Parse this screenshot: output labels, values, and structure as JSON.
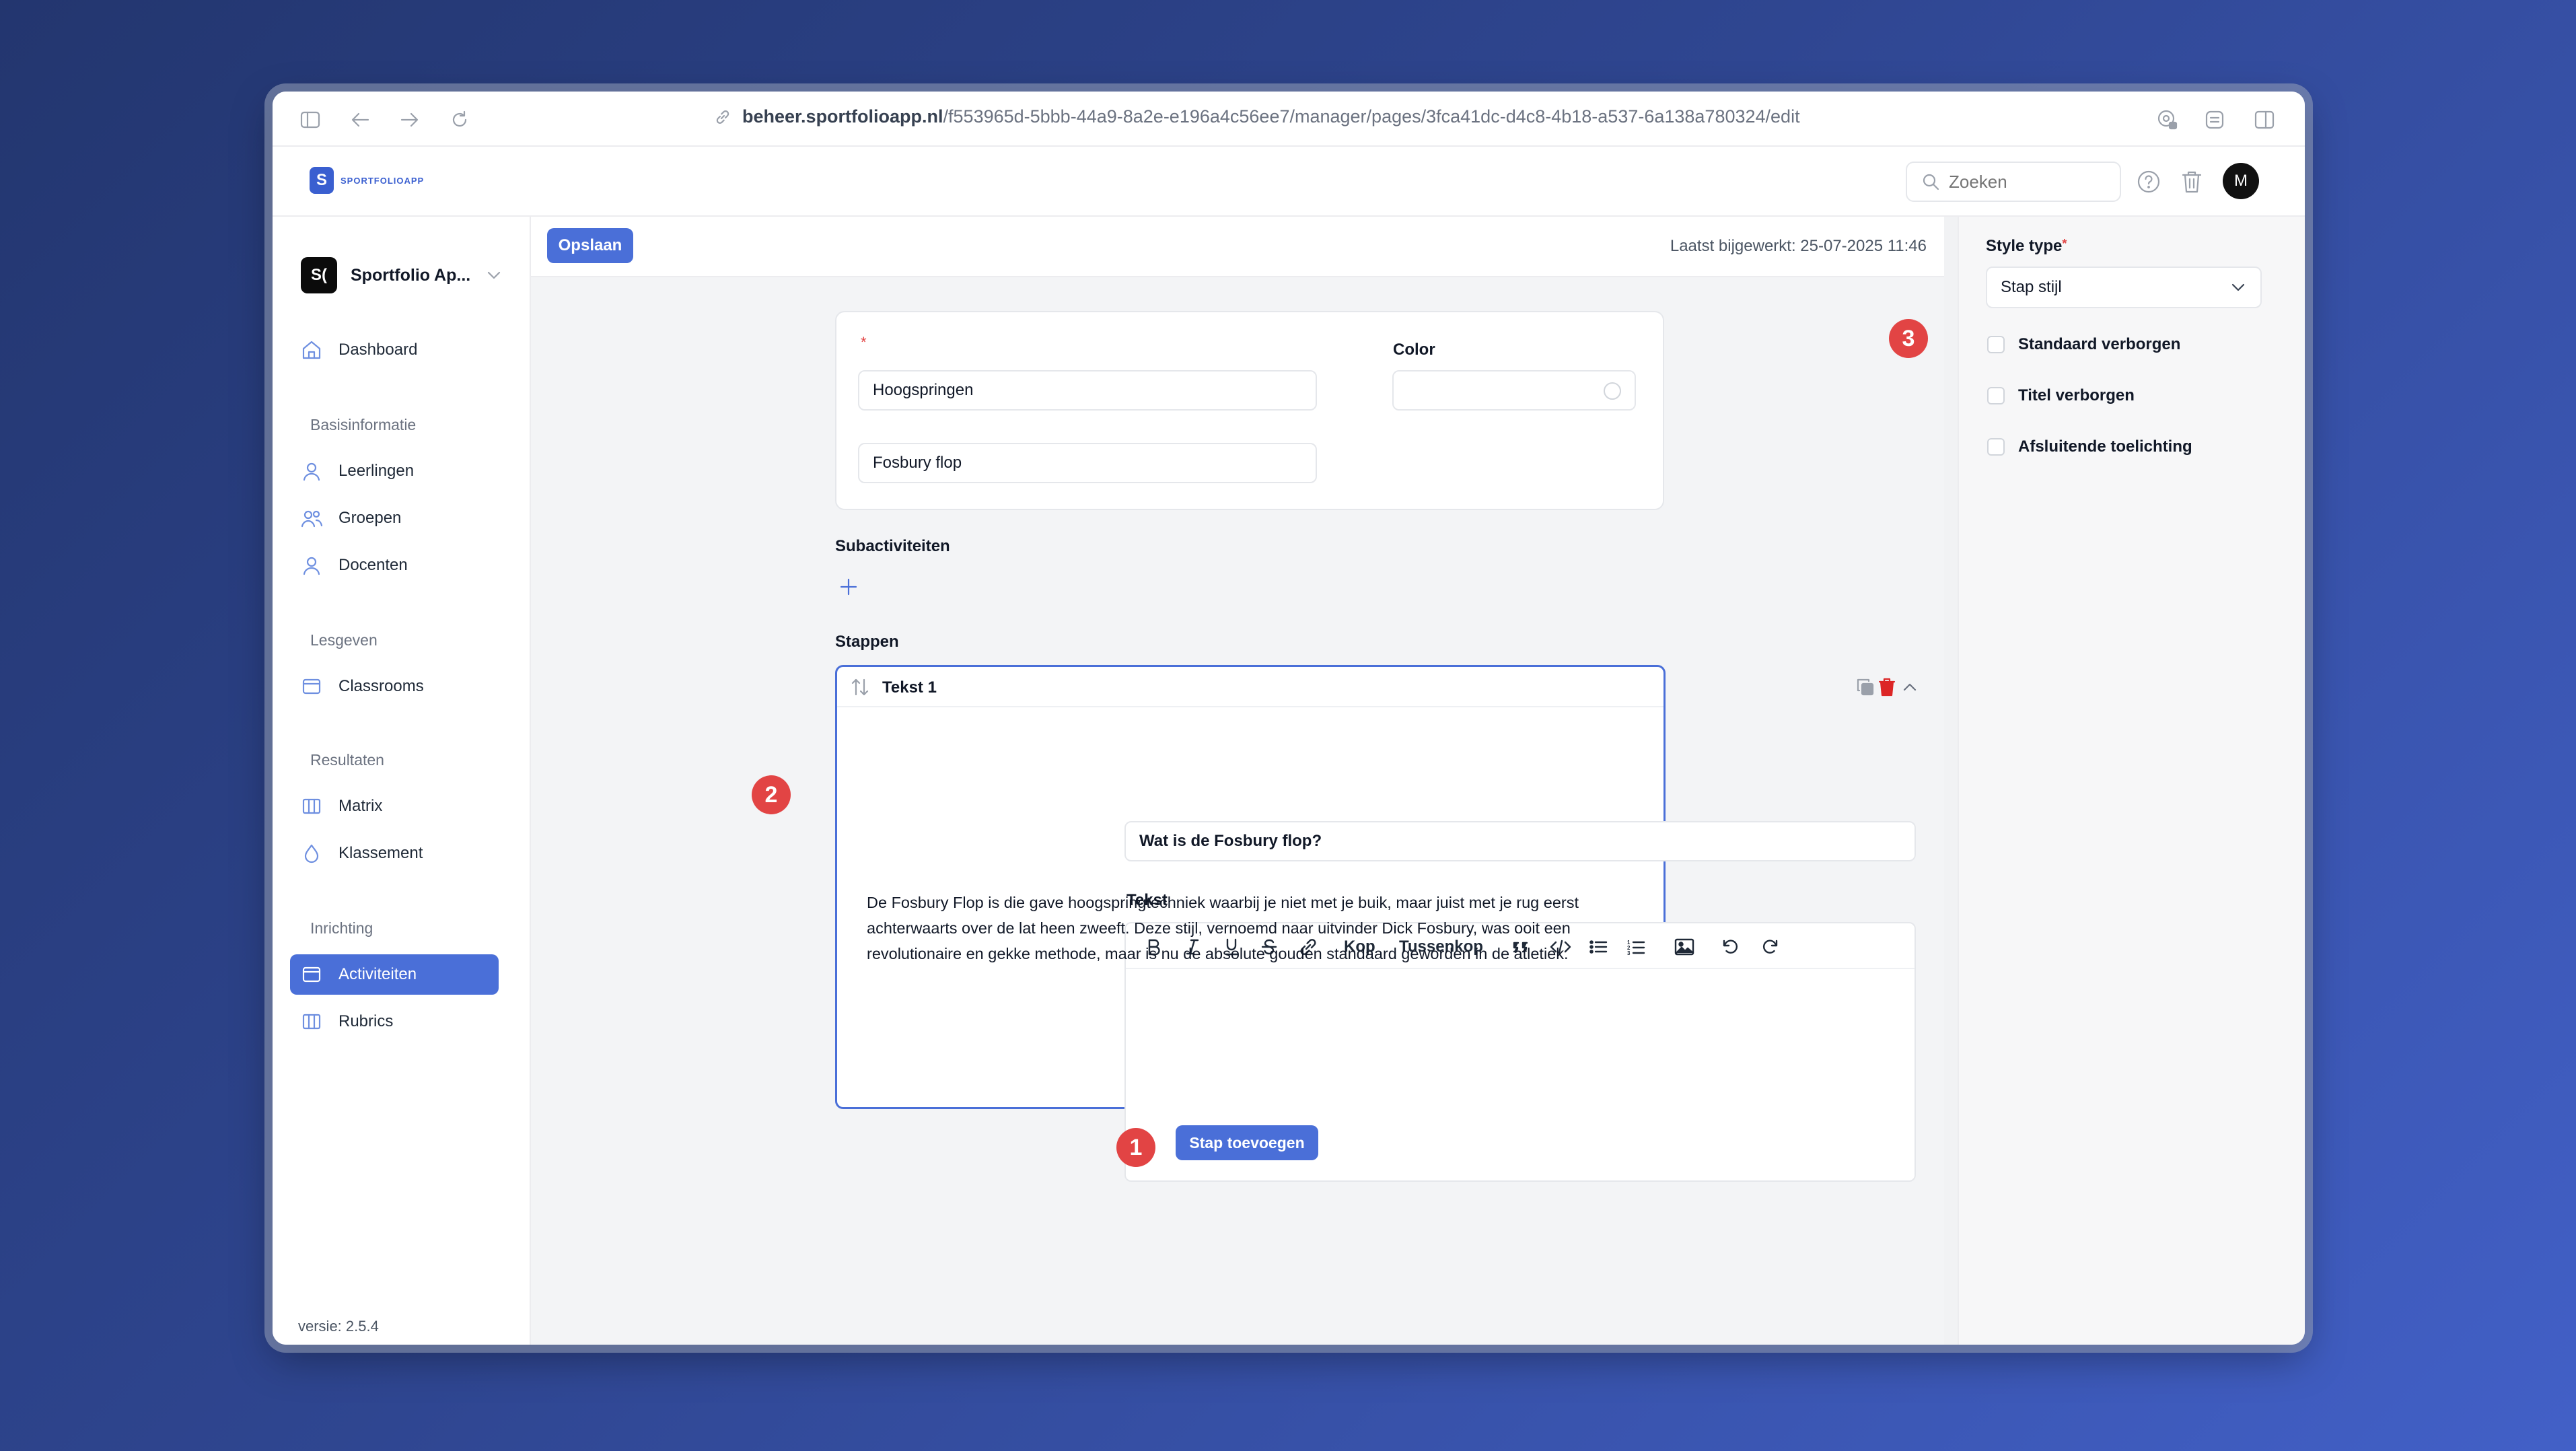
{
  "browser": {
    "url_host": "beheer.sportfolioapp.nl",
    "url_path": "/f553965d-5bbb-44a9-8a2e-e196a4c56ee7/manager/pages/3fca41dc-d4c8-4b18-a537-6a138a780324/edit"
  },
  "app": {
    "logo_text": "SPORTFOLIOAPP",
    "search_placeholder": "Zoeken",
    "avatar_initial": "M"
  },
  "sidebar": {
    "workspace": {
      "initials": "S(",
      "name": "Sportfolio Ap..."
    },
    "dashboard": "Dashboard",
    "sections": [
      {
        "title": "Basisinformatie",
        "items": [
          "Leerlingen",
          "Groepen",
          "Docenten"
        ]
      },
      {
        "title": "Lesgeven",
        "items": [
          "Classrooms"
        ]
      },
      {
        "title": "Resultaten",
        "items": [
          "Matrix",
          "Klassement"
        ]
      },
      {
        "title": "Inrichting",
        "items": [
          "Activiteiten",
          "Rubrics"
        ]
      }
    ],
    "active_item": "Activiteiten",
    "version": "versie: 2.5.4"
  },
  "toolbar": {
    "save_label": "Opslaan",
    "last_updated": "Laatst bijgewerkt: 25-07-2025 11:46"
  },
  "activity": {
    "required_mark": "*",
    "title_value": "Hoogspringen",
    "subtitle_value": "Fosbury flop",
    "color_label": "Color",
    "color_value": ""
  },
  "subactivities": {
    "label": "Subactiviteiten"
  },
  "steps": {
    "label": "Stappen",
    "items": [
      {
        "name": "Tekst 1",
        "title_value": "Wat is de Fosbury flop?",
        "text_label": "Tekst",
        "body": "De Fosbury Flop is die gave hoogspringtechniek waarbij je niet met je buik, maar juist met je rug eerst achterwaarts over de lat heen zweeft. Deze stijl, vernoemd naar uitvinder Dick Fosbury, was ooit een revolutionaire en gekke methode, maar is nu de absolute gouden standaard geworden in de atletiek."
      }
    ],
    "add_label": "Stap toevoegen"
  },
  "editor_toolbar": {
    "heading": "Kop",
    "subheading": "Tussenkop"
  },
  "right_panel": {
    "style_type_label": "Style type",
    "required_mark": "*",
    "style_type_value": "Stap stijl",
    "options": [
      "Standaard verborgen",
      "Titel verborgen",
      "Afsluitende toelichting"
    ]
  },
  "annotations": [
    "1",
    "2",
    "3"
  ],
  "colors": {
    "accent": "#4a6fd8",
    "annotation": "#e24444",
    "delete": "#dc2626"
  }
}
